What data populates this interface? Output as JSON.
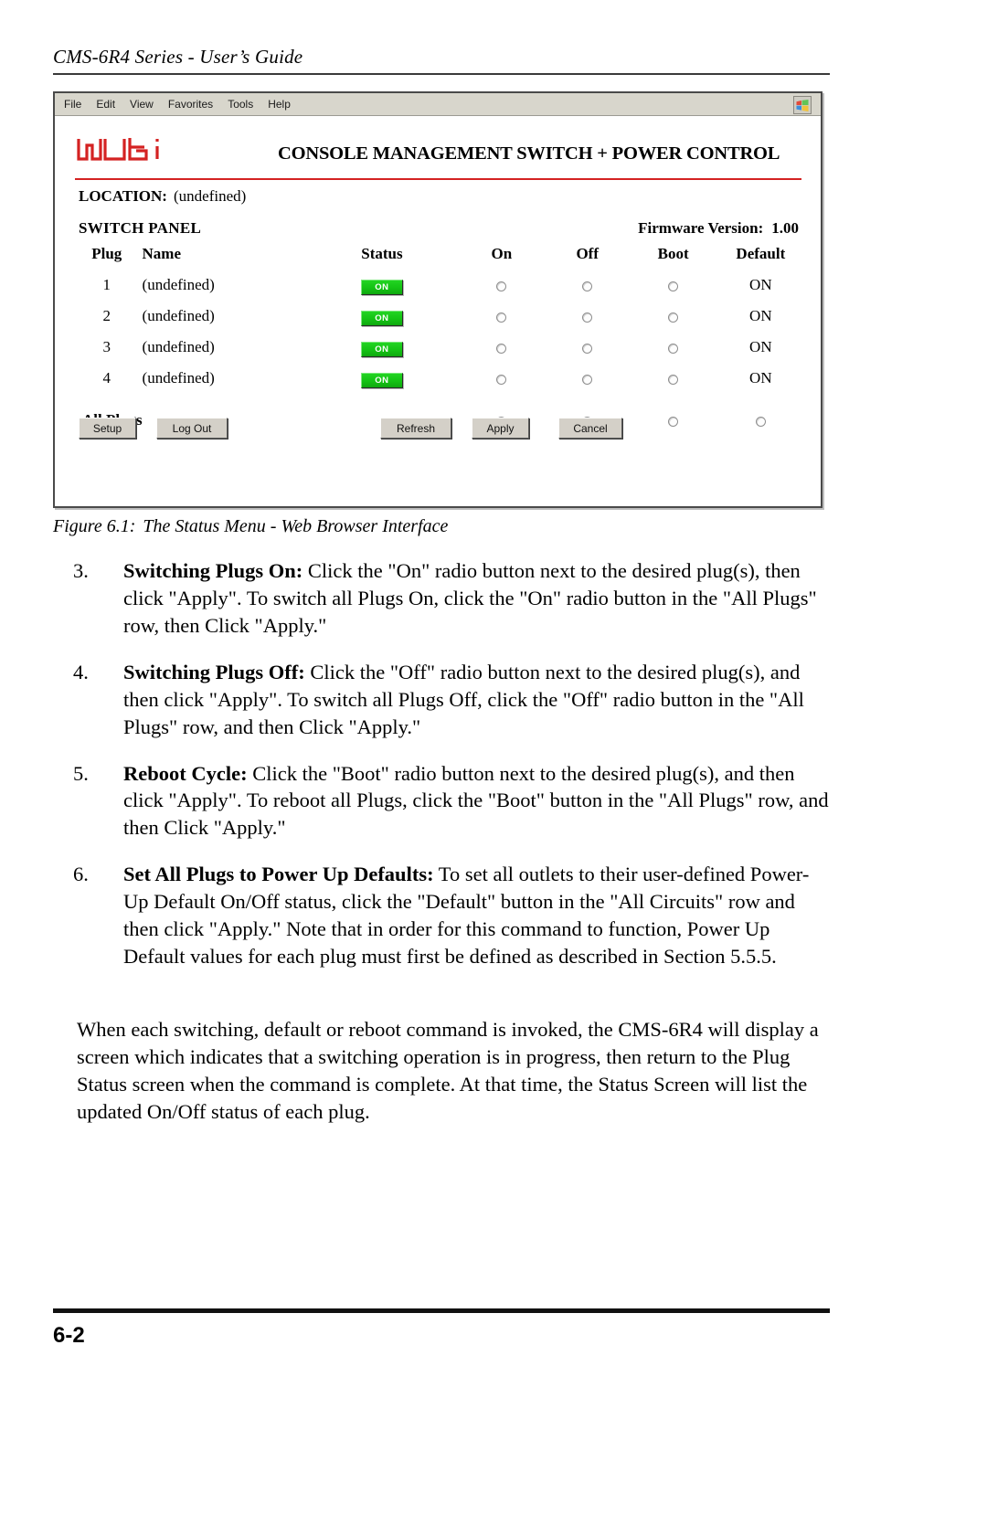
{
  "header": {
    "running_head": "CMS-6R4 Series - User’s Guide"
  },
  "figure": {
    "browser": {
      "menubar": [
        {
          "label": "File"
        },
        {
          "label": "Edit"
        },
        {
          "label": "View"
        },
        {
          "label": "Favorites"
        },
        {
          "label": "Tools"
        },
        {
          "label": "Help"
        }
      ],
      "window_logo_icon": "windows-flag-icon"
    },
    "page": {
      "logo_text": "wti",
      "logo_color": "#d42222",
      "banner_title": "CONSOLE MANAGEMENT SWITCH + POWER CONTROL",
      "location_label": "LOCATION:",
      "location_value": "(undefined)",
      "panel_title": "SWITCH PANEL",
      "firmware_label": "Firmware Version:",
      "firmware_value": "1.00",
      "table": {
        "columns": [
          "Plug",
          "Name",
          "Status",
          "On",
          "Off",
          "Boot",
          "Default"
        ],
        "rows": [
          {
            "plug": "1",
            "name": "(undefined)",
            "status": "ON",
            "default": "ON"
          },
          {
            "plug": "2",
            "name": "(undefined)",
            "status": "ON",
            "default": "ON"
          },
          {
            "plug": "3",
            "name": "(undefined)",
            "status": "ON",
            "default": "ON"
          },
          {
            "plug": "4",
            "name": "(undefined)",
            "status": "ON",
            "default": "ON"
          }
        ],
        "all_plugs_label": "All Plugs"
      },
      "buttons": {
        "setup": "Setup",
        "logout": "Log Out",
        "refresh": "Refresh",
        "apply": "Apply",
        "cancel": "Cancel"
      },
      "status_badge_color": "#14c214"
    },
    "caption_number": "Figure 6.1:",
    "caption_text": "The Status Menu - Web Browser Interface"
  },
  "steps": [
    {
      "num": "3.",
      "lead": "Switching Plugs On:",
      "body": " Click the \"On\" radio button next to the desired plug(s), then click \"Apply\".  To switch all Plugs On, click the \"On\" radio button in the \"All Plugs\" row, then Click \"Apply.\""
    },
    {
      "num": "4.",
      "lead": "Switching Plugs Off:",
      "body": " Click the \"Off\" radio button next to the desired plug(s), and then click \"Apply\".  To switch all Plugs Off, click the \"Off\" radio button in the \"All Plugs\" row, and then Click \"Apply.\""
    },
    {
      "num": "5.",
      "lead": "Reboot Cycle:",
      "body": " Click the \"Boot\" radio button next to the desired plug(s), and then click \"Apply\".  To reboot all Plugs, click the \"Boot\" button in the \"All Plugs\" row, and then Click \"Apply.\""
    },
    {
      "num": "6.",
      "lead": "Set All Plugs to Power Up Defaults:",
      "body": " To set all outlets to their user-defined Power-Up Default On/Off status, click the \"Default\" button in the \"All Circuits\" row and then click \"Apply.\"  Note that in order for this command to function, Power Up Default values for each plug must first be defined as described in Section 5.5.5."
    }
  ],
  "closing_paragraph": "When each switching, default or reboot command is invoked, the CMS-6R4 will display a screen which indicates that a switching operation is in progress, then return to the Plug Status screen when the command is complete.  At that time, the Status Screen will list the updated On/Off status of each plug.",
  "footer": {
    "page_number": "6-2"
  }
}
